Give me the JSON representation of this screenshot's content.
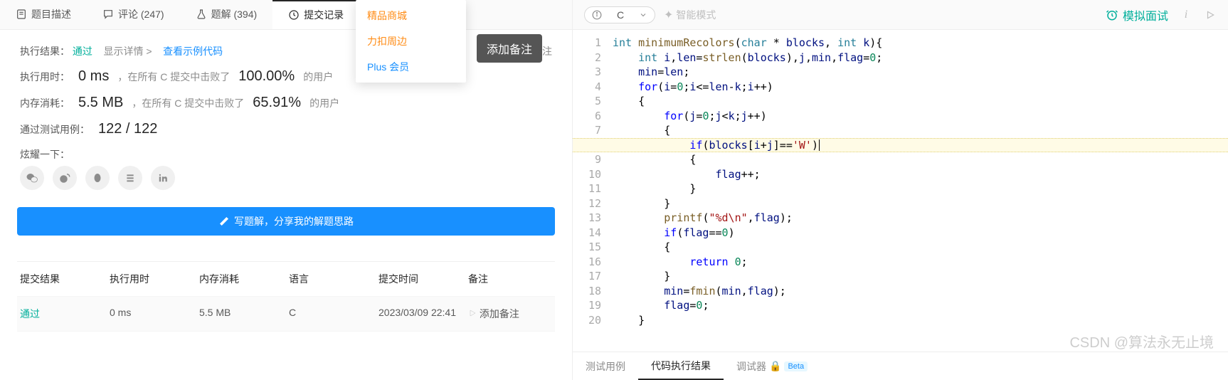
{
  "tabs": [
    {
      "label": "题目描述"
    },
    {
      "label": "评论 (247)"
    },
    {
      "label": "题解 (394)"
    },
    {
      "label": "提交记录"
    }
  ],
  "dropdown": [
    {
      "label": "精品商城"
    },
    {
      "label": "力扣周边"
    },
    {
      "label": "Plus 会员"
    }
  ],
  "tooltip": "添加备注",
  "result": {
    "label_result": "执行结果：",
    "status": "通过",
    "show_detail": "显示详情 >",
    "view_example": "查看示例代码",
    "add_note": "添加备注",
    "label_time": "执行用时：",
    "time": "0 ms",
    "time_suffix": "，在所有 C 提交中击败了",
    "time_pct": "100.00%",
    "pct_suffix": " 的用户",
    "label_mem": "内存消耗：",
    "mem": "5.5 MB",
    "mem_suffix": "，在所有 C 提交中击败了",
    "mem_pct": "65.91%",
    "label_cases": "通过测试用例：",
    "cases": "122 / 122",
    "label_boast": "炫耀一下："
  },
  "write_solution": "写题解，分享我的解题思路",
  "table": {
    "headers": [
      "提交结果",
      "执行用时",
      "内存消耗",
      "语言",
      "提交时间",
      "备注"
    ],
    "row": {
      "status": "通过",
      "time": "0 ms",
      "mem": "5.5 MB",
      "lang": "C",
      "ts": "2023/03/09 22:41",
      "note": "添加备注"
    }
  },
  "lang": "C",
  "smart_mode": "智能模式",
  "mock_interview": "模拟面试",
  "code_lines": [
    [
      {
        "c": "ty",
        "t": "int"
      },
      {
        "c": "pu",
        "t": " "
      },
      {
        "c": "fn",
        "t": "minimumRecolors"
      },
      {
        "c": "pu",
        "t": "("
      },
      {
        "c": "ty",
        "t": "char"
      },
      {
        "c": "pu",
        "t": " * "
      },
      {
        "c": "id",
        "t": "blocks"
      },
      {
        "c": "pu",
        "t": ", "
      },
      {
        "c": "ty",
        "t": "int"
      },
      {
        "c": "pu",
        "t": " "
      },
      {
        "c": "id",
        "t": "k"
      },
      {
        "c": "pu",
        "t": "){"
      }
    ],
    [
      {
        "c": "pu",
        "t": "    "
      },
      {
        "c": "ty",
        "t": "int"
      },
      {
        "c": "pu",
        "t": " "
      },
      {
        "c": "id",
        "t": "i"
      },
      {
        "c": "pu",
        "t": ","
      },
      {
        "c": "id",
        "t": "len"
      },
      {
        "c": "pu",
        "t": "="
      },
      {
        "c": "fn",
        "t": "strlen"
      },
      {
        "c": "pu",
        "t": "("
      },
      {
        "c": "id",
        "t": "blocks"
      },
      {
        "c": "pu",
        "t": "),"
      },
      {
        "c": "id",
        "t": "j"
      },
      {
        "c": "pu",
        "t": ","
      },
      {
        "c": "id",
        "t": "min"
      },
      {
        "c": "pu",
        "t": ","
      },
      {
        "c": "id",
        "t": "flag"
      },
      {
        "c": "pu",
        "t": "="
      },
      {
        "c": "num",
        "t": "0"
      },
      {
        "c": "pu",
        "t": ";"
      }
    ],
    [
      {
        "c": "pu",
        "t": "    "
      },
      {
        "c": "id",
        "t": "min"
      },
      {
        "c": "pu",
        "t": "="
      },
      {
        "c": "id",
        "t": "len"
      },
      {
        "c": "pu",
        "t": ";"
      }
    ],
    [
      {
        "c": "pu",
        "t": "    "
      },
      {
        "c": "kw",
        "t": "for"
      },
      {
        "c": "pu",
        "t": "("
      },
      {
        "c": "id",
        "t": "i"
      },
      {
        "c": "pu",
        "t": "="
      },
      {
        "c": "num",
        "t": "0"
      },
      {
        "c": "pu",
        "t": ";"
      },
      {
        "c": "id",
        "t": "i"
      },
      {
        "c": "pu",
        "t": "<="
      },
      {
        "c": "id",
        "t": "len"
      },
      {
        "c": "pu",
        "t": "-"
      },
      {
        "c": "id",
        "t": "k"
      },
      {
        "c": "pu",
        "t": ";"
      },
      {
        "c": "id",
        "t": "i"
      },
      {
        "c": "pu",
        "t": "++)"
      }
    ],
    [
      {
        "c": "pu",
        "t": "    {"
      }
    ],
    [
      {
        "c": "pu",
        "t": "        "
      },
      {
        "c": "kw",
        "t": "for"
      },
      {
        "c": "pu",
        "t": "("
      },
      {
        "c": "id",
        "t": "j"
      },
      {
        "c": "pu",
        "t": "="
      },
      {
        "c": "num",
        "t": "0"
      },
      {
        "c": "pu",
        "t": ";"
      },
      {
        "c": "id",
        "t": "j"
      },
      {
        "c": "pu",
        "t": "<"
      },
      {
        "c": "id",
        "t": "k"
      },
      {
        "c": "pu",
        "t": ";"
      },
      {
        "c": "id",
        "t": "j"
      },
      {
        "c": "pu",
        "t": "++)"
      }
    ],
    [
      {
        "c": "pu",
        "t": "        {"
      }
    ],
    [
      {
        "c": "pu",
        "t": "            "
      },
      {
        "c": "kw",
        "t": "if"
      },
      {
        "c": "pu",
        "t": "("
      },
      {
        "c": "id",
        "t": "blocks"
      },
      {
        "c": "pu",
        "t": "["
      },
      {
        "c": "id",
        "t": "i"
      },
      {
        "c": "pu",
        "t": "+"
      },
      {
        "c": "id",
        "t": "j"
      },
      {
        "c": "pu",
        "t": "]=="
      },
      {
        "c": "str",
        "t": "'W'"
      },
      {
        "c": "pu",
        "t": ")"
      }
    ],
    [
      {
        "c": "pu",
        "t": "            {"
      }
    ],
    [
      {
        "c": "pu",
        "t": "                "
      },
      {
        "c": "id",
        "t": "flag"
      },
      {
        "c": "pu",
        "t": "++;"
      }
    ],
    [
      {
        "c": "pu",
        "t": "            }"
      }
    ],
    [
      {
        "c": "pu",
        "t": "        }"
      }
    ],
    [
      {
        "c": "pu",
        "t": "        "
      },
      {
        "c": "fn",
        "t": "printf"
      },
      {
        "c": "pu",
        "t": "("
      },
      {
        "c": "str",
        "t": "\"%d\\n\""
      },
      {
        "c": "pu",
        "t": ","
      },
      {
        "c": "id",
        "t": "flag"
      },
      {
        "c": "pu",
        "t": ");"
      }
    ],
    [
      {
        "c": "pu",
        "t": "        "
      },
      {
        "c": "kw",
        "t": "if"
      },
      {
        "c": "pu",
        "t": "("
      },
      {
        "c": "id",
        "t": "flag"
      },
      {
        "c": "pu",
        "t": "=="
      },
      {
        "c": "num",
        "t": "0"
      },
      {
        "c": "pu",
        "t": ")"
      }
    ],
    [
      {
        "c": "pu",
        "t": "        {"
      }
    ],
    [
      {
        "c": "pu",
        "t": "            "
      },
      {
        "c": "kw",
        "t": "return"
      },
      {
        "c": "pu",
        "t": " "
      },
      {
        "c": "num",
        "t": "0"
      },
      {
        "c": "pu",
        "t": ";"
      }
    ],
    [
      {
        "c": "pu",
        "t": "        }"
      }
    ],
    [
      {
        "c": "pu",
        "t": "        "
      },
      {
        "c": "id",
        "t": "min"
      },
      {
        "c": "pu",
        "t": "="
      },
      {
        "c": "fn",
        "t": "fmin"
      },
      {
        "c": "pu",
        "t": "("
      },
      {
        "c": "id",
        "t": "min"
      },
      {
        "c": "pu",
        "t": ","
      },
      {
        "c": "id",
        "t": "flag"
      },
      {
        "c": "pu",
        "t": ");"
      }
    ],
    [
      {
        "c": "pu",
        "t": "        "
      },
      {
        "c": "id",
        "t": "flag"
      },
      {
        "c": "pu",
        "t": "="
      },
      {
        "c": "num",
        "t": "0"
      },
      {
        "c": "pu",
        "t": ";"
      }
    ],
    [
      {
        "c": "pu",
        "t": "    }"
      }
    ]
  ],
  "highlight_line": 8,
  "bottom_tabs": [
    {
      "label": "测试用例"
    },
    {
      "label": "代码执行结果"
    },
    {
      "label": "调试器",
      "lock": true,
      "beta": "Beta"
    }
  ],
  "watermark": "CSDN @算法永无止境"
}
